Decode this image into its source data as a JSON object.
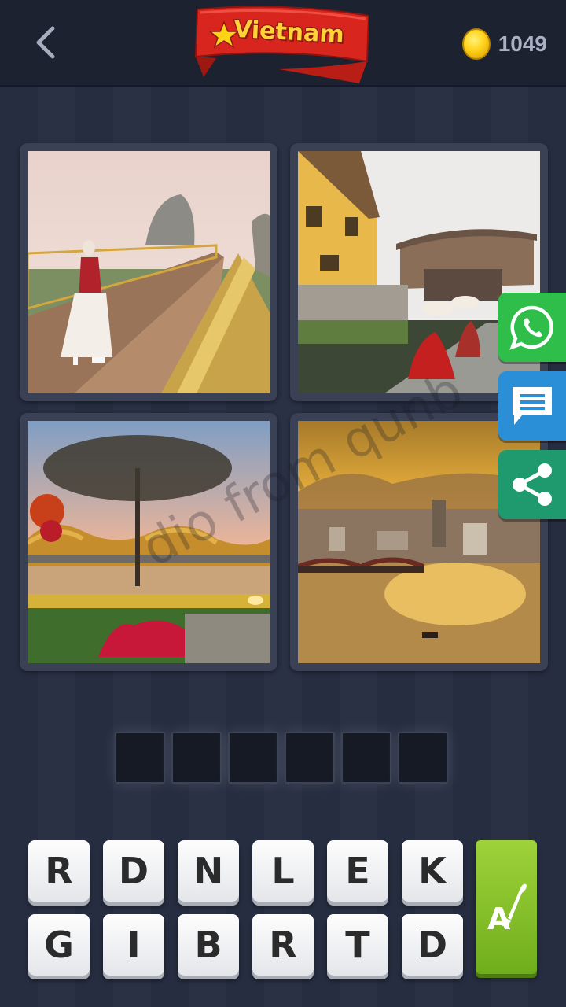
{
  "header": {
    "back_icon": "chevron-left-icon",
    "category_banner": "Vietnam",
    "coin_icon": "coin-icon",
    "coin_count": "1049"
  },
  "watermark": "dio from qunb",
  "side_buttons": [
    {
      "name": "whatsapp",
      "icon": "whatsapp-icon",
      "color": "#2fbe4a"
    },
    {
      "name": "message",
      "icon": "message-icon",
      "color": "#2a8fd6"
    },
    {
      "name": "share",
      "icon": "share-icon",
      "color": "#1f9a6e"
    }
  ],
  "answer": {
    "slot_count": 6,
    "slots": [
      "",
      "",
      "",
      "",
      "",
      ""
    ]
  },
  "keyboard": {
    "row1": [
      "R",
      "D",
      "N",
      "L",
      "E",
      "K"
    ],
    "row2": [
      "G",
      "I",
      "B",
      "R",
      "T",
      "D"
    ],
    "hint_icon": "magic-brush-icon",
    "hint_label": "A"
  },
  "colors": {
    "background": "#262d40",
    "topbar": "#1d2231",
    "banner_red": "#d8261f",
    "banner_text": "#ffd23a",
    "hint_green": "#8cc92d"
  }
}
